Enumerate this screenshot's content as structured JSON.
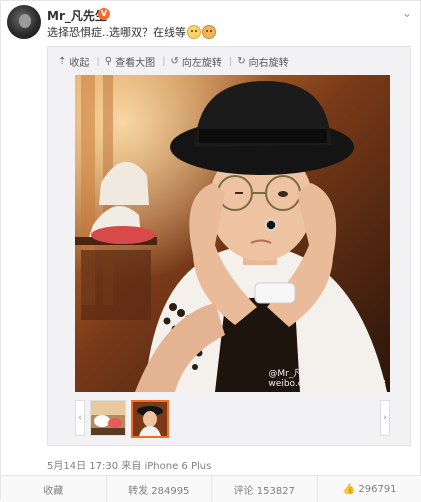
{
  "post": {
    "username": "Mr_凡先生",
    "text": "选择恐惧症..选哪双？在线等",
    "meta_time": "5月14日 17:30",
    "meta_from": "来自",
    "meta_source": "iPhone 6 Plus"
  },
  "toolbar": {
    "collapse_label": "收起",
    "view_large_label": "查看大图",
    "rotate_left_label": "向左旋转",
    "rotate_right_label": "向右旋转"
  },
  "photo": {
    "watermark": "@Mr_凡先生",
    "watermark_url": "weibo.com/u/3591355593"
  },
  "actions": {
    "favorite_label": "收藏",
    "repost_label": "转发 284995",
    "comment_label": "评论 153827",
    "like_count": "296791"
  },
  "colors": {
    "accent": "#f26d2a",
    "meta_gray": "#808080"
  }
}
